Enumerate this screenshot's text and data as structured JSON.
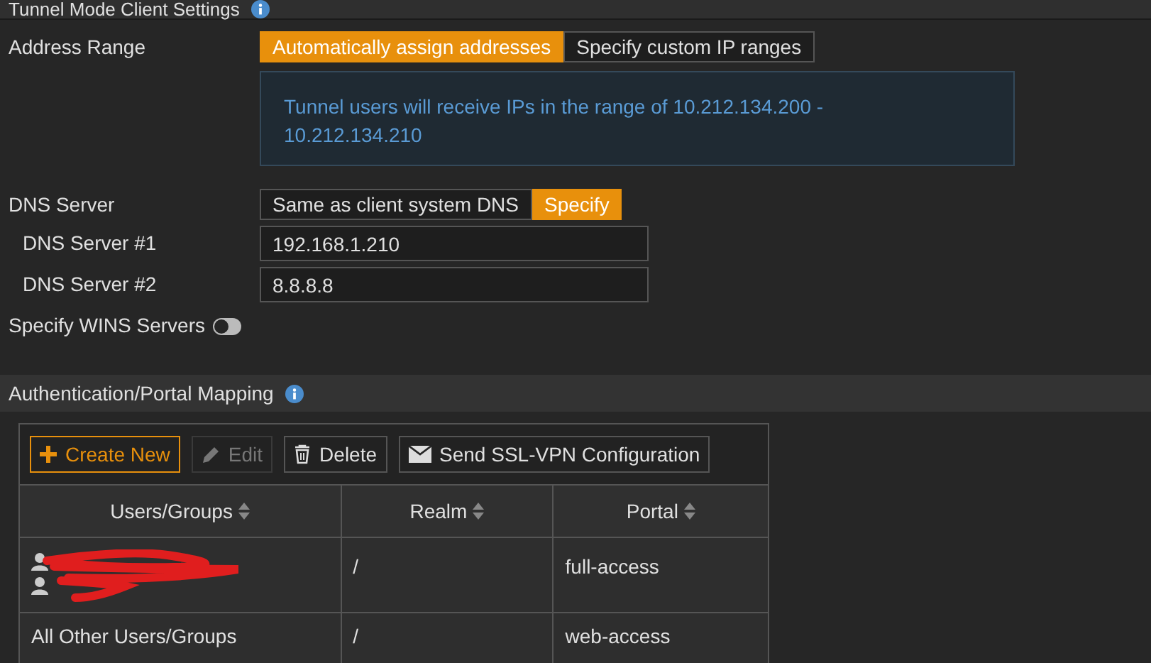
{
  "section_title": "Tunnel Mode Client Settings",
  "address_range": {
    "label": "Address Range",
    "options": [
      {
        "label": "Automatically assign addresses",
        "selected": true
      },
      {
        "label": "Specify custom IP ranges",
        "selected": false
      }
    ],
    "info": "Tunnel users will receive IPs in the range of 10.212.134.200 - 10.212.134.210"
  },
  "dns_server": {
    "label": "DNS Server",
    "options": [
      {
        "label": "Same as client system DNS",
        "selected": false
      },
      {
        "label": "Specify",
        "selected": true
      }
    ]
  },
  "dns_fields": [
    {
      "label": "DNS Server #1",
      "value": "192.168.1.210"
    },
    {
      "label": "DNS Server #2",
      "value": "8.8.8.8"
    }
  ],
  "wins": {
    "label": "Specify WINS Servers",
    "on": false
  },
  "mapping_title": "Authentication/Portal Mapping",
  "toolbar": [
    {
      "kind": "create",
      "label": "Create New",
      "disabled": false
    },
    {
      "kind": "edit",
      "label": "Edit",
      "disabled": true
    },
    {
      "kind": "delete",
      "label": "Delete",
      "disabled": false
    },
    {
      "kind": "mail",
      "label": "Send SSL-VPN Configuration",
      "disabled": false
    }
  ],
  "table": {
    "columns": [
      "Users/Groups",
      "Realm",
      "Portal"
    ],
    "rows": [
      {
        "kind": "redacted",
        "realm": "/",
        "portal": "full-access"
      },
      {
        "kind": "text",
        "users_groups": "All Other Users/Groups",
        "realm": "/",
        "portal": "web-access"
      }
    ]
  }
}
